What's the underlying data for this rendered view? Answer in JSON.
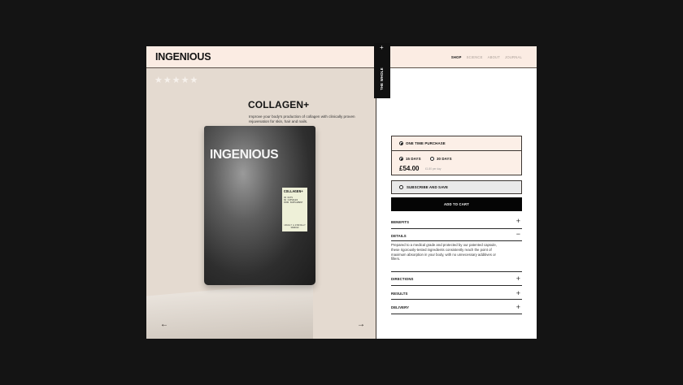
{
  "header": {
    "brand": "INGENIOUS",
    "nav": [
      "SHOP",
      "SCIENCE",
      "ABOUT",
      "JOURNAL"
    ]
  },
  "gallery": {
    "rating_stars": 5,
    "pouch_brand": "INGENIOUS",
    "pouch_label_title": "COLLAGEN+",
    "pouch_label_lines": [
      "30 DAYS",
      "60 CAPSULES",
      "FOOD SUPPLEMENT"
    ],
    "pouch_label_bottom": "LOCALLY & ETHICALLY SOURCED",
    "prev_arrow": "←",
    "next_arrow": "→"
  },
  "side_tab": {
    "plus": "+",
    "label": "THE WHOLE STORY"
  },
  "product": {
    "title": "COLLAGEN+",
    "description": "Improve your body's production of collagen with clinically proven rejuvenation for skin, hair and nails."
  },
  "purchase": {
    "one_time": "ONE TIME PURCHASE",
    "option_15": "15 DAYS",
    "option_30": "30 DAYS",
    "price": "£54.00",
    "per_day": "£1.80 per day",
    "subscribe": "SUBSCRIBE AND SAVE",
    "add_to_cart": "ADD TO CART"
  },
  "accordion": [
    {
      "label": "BENEFITS",
      "sign": "+"
    },
    {
      "label": "DETAILS",
      "sign": "−",
      "body": "Prepared to a medical grade and protected by our patented capsule, these rigorously-tested ingredients consistently reach the point of maximum absorption in your body, with no unnecessary additives or fillers."
    },
    {
      "label": "DIRECTIONS",
      "sign": "+"
    },
    {
      "label": "RESULTS",
      "sign": "+"
    },
    {
      "label": "DELIVERY",
      "sign": "+"
    }
  ],
  "colors": {
    "page_bg": "#141414",
    "header_bg": "#fbece3",
    "gallery_bg": "#e4dad0",
    "option_bg": "#fcefe7",
    "button_bg": "#050505"
  }
}
